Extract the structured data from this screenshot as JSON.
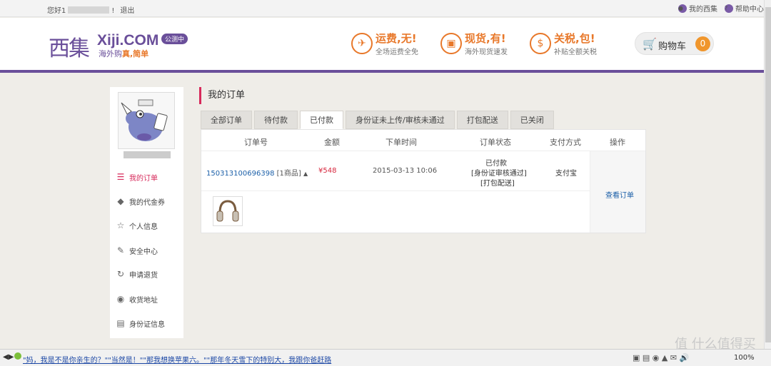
{
  "topbar": {
    "greeting": "您好1",
    "greeting_suffix": "!",
    "logout": "退出",
    "my_xiji": "我的西集",
    "help": "帮助中心"
  },
  "header": {
    "logo_cn": "西集",
    "logo_en": "Xiji.COM",
    "slogan_a": "海外购",
    "slogan_b": "真,简单",
    "beta_badge": "公测中",
    "promos": [
      {
        "title": "运费,无!",
        "sub": "全场运费全免",
        "icon": "✈"
      },
      {
        "title": "现货,有!",
        "sub": "海外现货速发",
        "icon": "▣"
      },
      {
        "title": "关税,包!",
        "sub": "补贴全额关税",
        "icon": "$"
      }
    ],
    "cart_label": "购物车",
    "cart_count": "0"
  },
  "sidebar": {
    "items": [
      {
        "label": "我的订单",
        "icon": "list-icon"
      },
      {
        "label": "我的代金券",
        "icon": "tag-icon"
      },
      {
        "label": "个人信息",
        "icon": "star-icon"
      },
      {
        "label": "安全中心",
        "icon": "edit-icon"
      },
      {
        "label": "申请退货",
        "icon": "refresh-icon"
      },
      {
        "label": "收货地址",
        "icon": "location-icon"
      },
      {
        "label": "身份证信息",
        "icon": "id-card-icon"
      }
    ]
  },
  "main": {
    "title": "我的订单",
    "tabs": [
      "全部订单",
      "待付款",
      "已付款",
      "身份证未上传/审核未通过",
      "打包配送",
      "已关闭"
    ],
    "columns": [
      "订单号",
      "金额",
      "下单时间",
      "订单状态",
      "支付方式",
      "操作"
    ],
    "order": {
      "number": "150313100696398",
      "items": "[1商品]",
      "amount": "¥548",
      "time": "2015-03-13 10:06",
      "status_1": "已付款",
      "status_2": "[身份证审核通过]",
      "status_3": "[打包配送]",
      "payment": "支付宝",
      "action": "查看订单"
    }
  },
  "bottombar": {
    "news": "\"妈，我是不是你亲生的？\"\"当然是！\"\"那我想换苹果六。\"\"那年冬天雪下的特别大，我跟你爸赶路",
    "zoom": "100%"
  },
  "watermark": "值 什么值得买"
}
